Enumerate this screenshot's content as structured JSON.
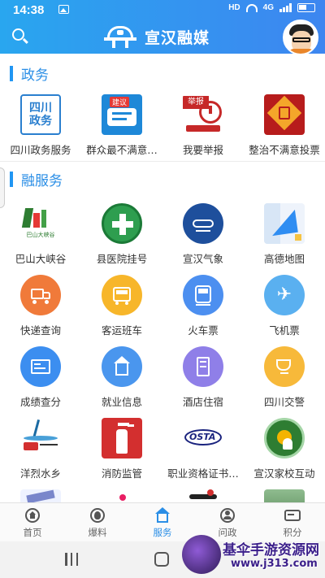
{
  "status_bar": {
    "time": "14:38",
    "hd": "HD",
    "network": "4G"
  },
  "header": {
    "title": "宣汉融媒"
  },
  "sections": {
    "gov": {
      "label": "政务",
      "items": [
        {
          "label": "四川政务服务",
          "icon": "sichuan-gov-logo-icon"
        },
        {
          "label": "群众最不满意…",
          "icon": "suggestion-icon"
        },
        {
          "label": "我要举报",
          "icon": "report-icon"
        },
        {
          "label": "整治不满意投票",
          "icon": "vote-icon"
        }
      ]
    },
    "services": {
      "label": "融服务",
      "items": [
        {
          "label": "巴山大峡谷",
          "icon": "bashan-canyon-logo-icon"
        },
        {
          "label": "县医院挂号",
          "icon": "hospital-logo-icon"
        },
        {
          "label": "宣汉气象",
          "icon": "weather-icon"
        },
        {
          "label": "高德地图",
          "icon": "amap-icon"
        },
        {
          "label": "快递查询",
          "icon": "delivery-truck-icon"
        },
        {
          "label": "客运班车",
          "icon": "bus-icon"
        },
        {
          "label": "火车票",
          "icon": "train-icon"
        },
        {
          "label": "飞机票",
          "icon": "plane-icon"
        },
        {
          "label": "成绩查分",
          "icon": "score-card-icon"
        },
        {
          "label": "就业信息",
          "icon": "job-house-icon"
        },
        {
          "label": "酒店住宿",
          "icon": "hotel-building-icon"
        },
        {
          "label": "四川交警",
          "icon": "police-cup-icon"
        },
        {
          "label": "洋烈水乡",
          "icon": "water-town-logo-icon"
        },
        {
          "label": "消防监管",
          "icon": "fire-extinguisher-icon"
        },
        {
          "label": "职业资格证书…",
          "icon": "osta-logo-icon"
        },
        {
          "label": "宣汉家校互动",
          "icon": "school-logo-icon"
        }
      ],
      "extra_icon_osta": "OSTA",
      "bashan_text": "巴山大峡谷"
    }
  },
  "tiles": {
    "gov1": "四川\n政务",
    "gov2": "建议",
    "gov3": "举报"
  },
  "bottom_nav": [
    {
      "label": "首页",
      "icon": "home-icon"
    },
    {
      "label": "爆料",
      "icon": "fire-icon"
    },
    {
      "label": "服务",
      "icon": "service-house-icon",
      "active": true
    },
    {
      "label": "问政",
      "icon": "person-icon"
    },
    {
      "label": "积分",
      "icon": "points-icon"
    }
  ],
  "watermark": {
    "title": "基伞手游资源网",
    "url": "www.j313.com"
  },
  "colors": {
    "accent": "#2a8ee6",
    "header": "#29a6ef"
  }
}
